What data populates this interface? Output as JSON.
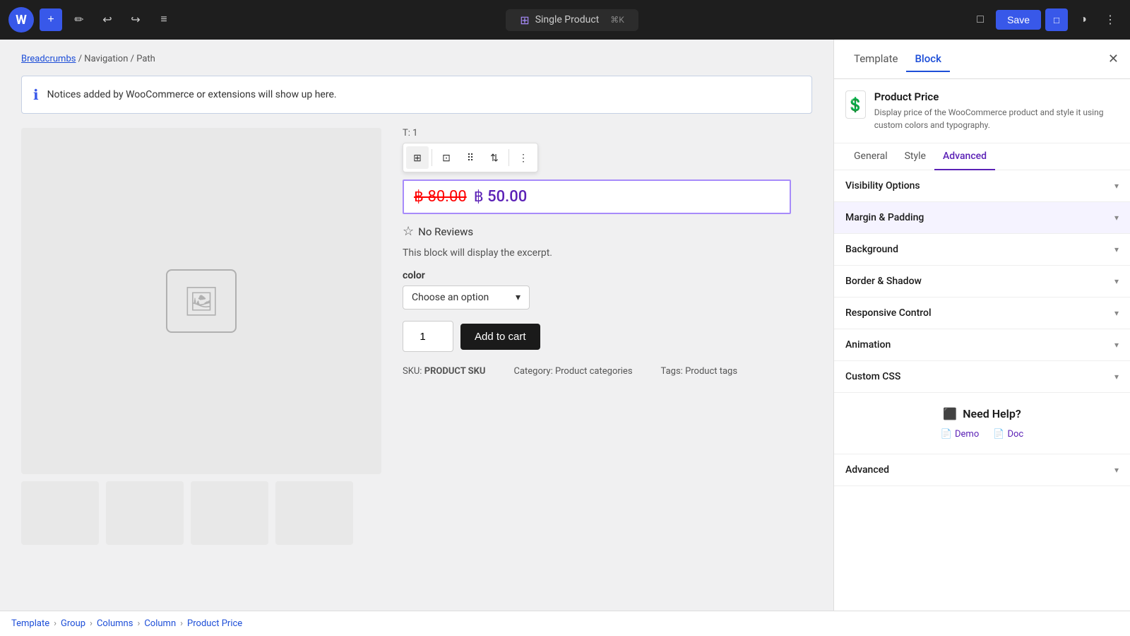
{
  "topbar": {
    "wp_logo": "W",
    "add_label": "+",
    "edit_label": "✏",
    "undo_label": "↩",
    "redo_label": "↪",
    "list_label": "≡",
    "title": "Single Product",
    "shortcut": "⌘K",
    "save_label": "Save",
    "view_label": "□",
    "theme_label": "◑",
    "more_label": "⋮"
  },
  "breadcrumb": {
    "link": "Breadcrumbs",
    "path": "/ Navigation / Path"
  },
  "notice": {
    "icon": "ℹ",
    "text": "Notices added by WooCommerce or extensions will show up here."
  },
  "product": {
    "price_original": "฿ 80.00",
    "price_sale": "฿ 50.00",
    "reviews": "No Reviews",
    "excerpt": "This block will display the excerpt.",
    "color_label": "color",
    "color_option": "Choose an option",
    "quantity": "1",
    "add_cart_label": "Add to cart",
    "sku_label": "SKU:",
    "sku_value": "PRODUCT SKU",
    "category_label": "Category:",
    "category_value": "Product categories",
    "tags_label": "Tags:",
    "tags_value": "Product tags"
  },
  "sidebar": {
    "tab_template": "Template",
    "tab_block": "Block",
    "close_label": "✕",
    "block_info": {
      "title": "Product Price",
      "description": "Display price of the WooCommerce product and style it using custom colors and typography."
    },
    "inner_tabs": [
      "General",
      "Style",
      "Advanced"
    ],
    "active_inner_tab": "Advanced",
    "sections": [
      {
        "id": "visibility-options",
        "label": "Visibility Options",
        "highlighted": false
      },
      {
        "id": "margin-padding",
        "label": "Margin & Padding",
        "highlighted": true
      },
      {
        "id": "background",
        "label": "Background",
        "highlighted": false
      },
      {
        "id": "border-shadow",
        "label": "Border & Shadow",
        "highlighted": false
      },
      {
        "id": "responsive-control",
        "label": "Responsive Control",
        "highlighted": false
      },
      {
        "id": "animation",
        "label": "Animation",
        "highlighted": false
      },
      {
        "id": "custom-css",
        "label": "Custom CSS",
        "highlighted": false
      }
    ],
    "need_help": {
      "title": "Need Help?",
      "demo_label": "Demo",
      "doc_label": "Doc"
    },
    "advanced_footer": {
      "label": "Advanced"
    }
  },
  "bottom_bar": {
    "items": [
      "Template",
      "Group",
      "Columns",
      "Column",
      "Product Price"
    ]
  },
  "block_toolbar": {
    "title_indicator": "T: 1"
  }
}
